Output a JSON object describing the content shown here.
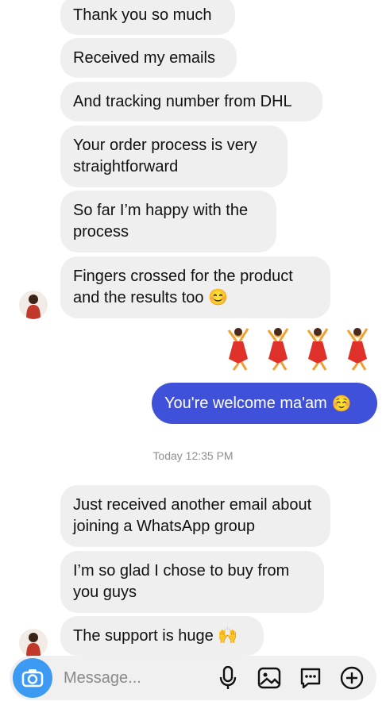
{
  "thread": {
    "incoming_a": [
      "Thank you so much",
      "Received my emails",
      "And tracking number from DHL",
      "Your order process is very straightforward",
      "So far I’m happy with the process",
      "Fingers crossed for the product and the results too"
    ],
    "incoming_a_emoji": "😊",
    "outgoing": "You're welcome ma'am",
    "outgoing_emoji": "☺️",
    "timestamp": "Today 12:35 PM",
    "incoming_b": [
      "Just received another email about joining a WhatsApp group",
      "I’m so glad I chose to buy from you guys",
      "The support is huge"
    ],
    "incoming_b_emoji": "🙌"
  },
  "composer": {
    "placeholder": "Message..."
  },
  "icons": [
    "camera-icon",
    "microphone-icon",
    "gallery-icon",
    "sticker-icon",
    "add-icon",
    "dancer-emoji"
  ],
  "colors": {
    "outgoing_bubble": "#3f51d8",
    "incoming_bubble": "#efefef",
    "camera_button": "#3d9af2"
  }
}
